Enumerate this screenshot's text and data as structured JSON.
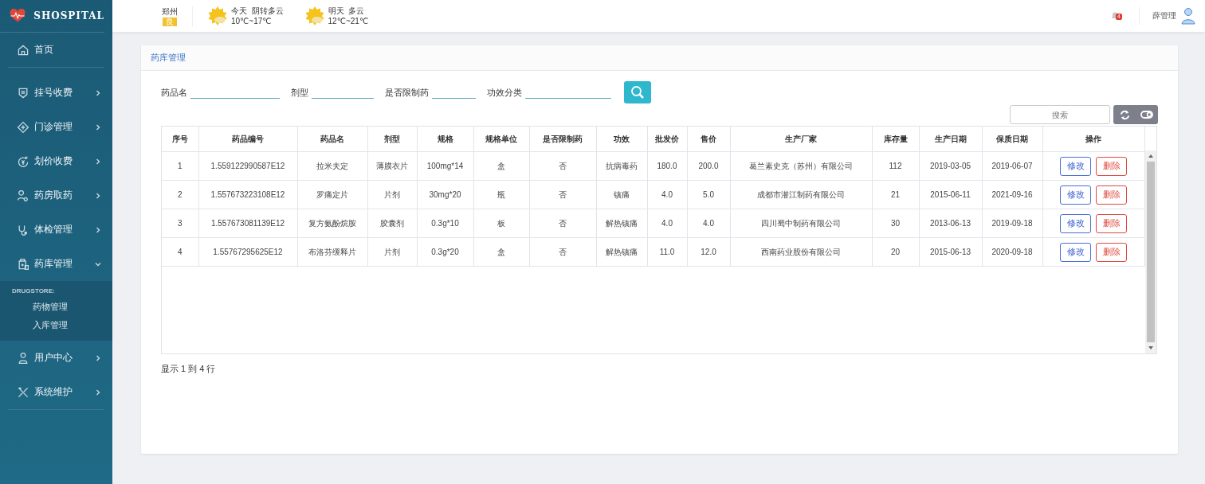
{
  "sidebar": {
    "logo": "SHOSPITAL",
    "items": [
      {
        "label": "首页",
        "kind": "link"
      },
      {
        "label": "挂号收费",
        "kind": "group",
        "expanded": false
      },
      {
        "label": "门诊管理",
        "kind": "group",
        "expanded": false
      },
      {
        "label": "划价收费",
        "kind": "group",
        "expanded": false
      },
      {
        "label": "药房取药",
        "kind": "group",
        "expanded": false
      },
      {
        "label": "体检管理",
        "kind": "group",
        "expanded": false
      },
      {
        "label": "药库管理",
        "kind": "group",
        "expanded": true,
        "section": "DRUGSTORE:",
        "children": [
          {
            "label": "药物管理"
          },
          {
            "label": "入库管理"
          }
        ]
      },
      {
        "label": "用户中心",
        "kind": "group",
        "expanded": false
      },
      {
        "label": "系统维护",
        "kind": "group",
        "expanded": false
      }
    ]
  },
  "header": {
    "city": "郑州",
    "air_quality": "良",
    "weather": [
      {
        "day": "今天",
        "condition": "阴转多云",
        "range": "10℃~17℃"
      },
      {
        "day": "明天",
        "condition": "多云",
        "range": "12℃~21℃"
      }
    ],
    "notifications": "4",
    "user": "薛管理"
  },
  "panel": {
    "title": "药库管理",
    "filters": [
      {
        "label": "药品名"
      },
      {
        "label": "剂型"
      },
      {
        "label": "是否限制药"
      },
      {
        "label": "功效分类"
      }
    ],
    "search_placeholder": "搜索",
    "table": {
      "columns": [
        "序号",
        "药品编号",
        "药品名",
        "剂型",
        "规格",
        "规格单位",
        "是否限制药",
        "功效",
        "批发价",
        "售价",
        "生产厂家",
        "库存量",
        "生产日期",
        "保质日期",
        "操作"
      ],
      "rows": [
        {
          "cells": [
            "1",
            "1.559122990587E12",
            "拉米夫定",
            "薄膜衣片",
            "100mg*14",
            "盒",
            "否",
            "抗病毒药",
            "180.0",
            "200.0",
            "葛兰素史克（苏州）有限公司",
            "112",
            "2019-03-05",
            "2019-06-07"
          ],
          "actions": [
            "修改",
            "删除"
          ]
        },
        {
          "cells": [
            "2",
            "1.557673223108E12",
            "罗痛定片",
            "片剂",
            "30mg*20",
            "瓶",
            "否",
            "镇痛",
            "4.0",
            "5.0",
            "成都市潜江制药有限公司",
            "21",
            "2015-06-11",
            "2021-09-16"
          ],
          "actions": [
            "修改",
            "删除"
          ]
        },
        {
          "cells": [
            "3",
            "1.557673081139E12",
            "复方氨酚烷胺",
            "胶囊剂",
            "0.3g*10",
            "板",
            "否",
            "解热镇痛",
            "4.0",
            "4.0",
            "四川蜀中制药有限公司",
            "30",
            "2013-06-13",
            "2019-09-18"
          ],
          "actions": [
            "修改",
            "删除"
          ]
        },
        {
          "cells": [
            "4",
            "1.55767295625E12",
            "布洛芬缓释片",
            "片剂",
            "0.3g*20",
            "盒",
            "否",
            "解热镇痛",
            "11.0",
            "12.0",
            "西南药业股份有限公司",
            "20",
            "2015-06-13",
            "2020-09-18"
          ],
          "actions": [
            "修改",
            "删除"
          ]
        }
      ]
    },
    "footer": "显示 1 到 4 行"
  }
}
